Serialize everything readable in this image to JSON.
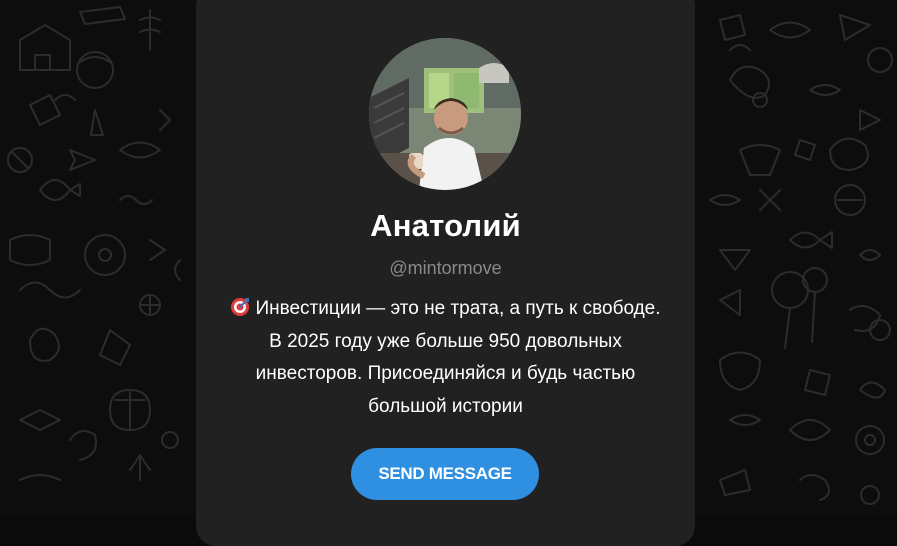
{
  "profile": {
    "name": "Анатолий",
    "username": "@mintormove",
    "bio_lines": [
      "Инвестиции — это не трата, а путь к свободе.",
      "В 2025 году уже больше 950 довольных",
      "инвесторов. Присоединяйся и будь частью",
      "большой истории"
    ],
    "bio_emoji_icon": "direct-hit-target-icon"
  },
  "actions": {
    "send_message_label": "SEND MESSAGE"
  },
  "colors": {
    "page_background": "#0d0d0d",
    "card_background": "#212121",
    "accent_button": "#2f8fe0",
    "username_text": "#8a8a8a"
  }
}
